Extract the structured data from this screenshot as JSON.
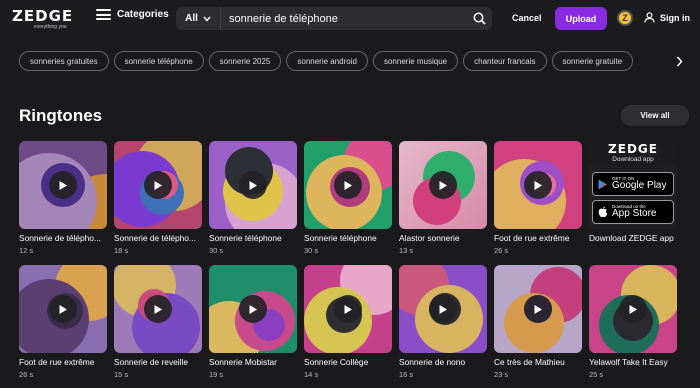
{
  "header": {
    "logo_text": "ZEDGE",
    "logo_tagline": "everything you",
    "categories_label": "Categories",
    "search_filter_value": "All",
    "search_value": "sonnerie de téléphone",
    "cancel_label": "Cancel",
    "upload_label": "Upload",
    "coin_label": "Z",
    "signin_label": "Sign in"
  },
  "tags": [
    "sonneries gratuites",
    "sonnerie téléphone",
    "sonnerie 2025",
    "sonnerie android",
    "sonnerie musique",
    "chanteur francais",
    "sonnerie gratuite"
  ],
  "section": {
    "title": "Ringtones",
    "view_all_label": "View all"
  },
  "ad": {
    "logo": "ZEDGE",
    "subtitle": "Download app",
    "google_small": "GET IT ON",
    "google_big": "Google Play",
    "apple_small": "Download on the",
    "apple_big": "App Store",
    "title": "Download ZEDGE app"
  },
  "row1": [
    {
      "title": "Sonnerie de télépho...",
      "duration": "12 s"
    },
    {
      "title": "Sonnerie de télépho...",
      "duration": "18 s"
    },
    {
      "title": "Sonnerie téléphone",
      "duration": "30 s"
    },
    {
      "title": "Sonnerie téléphone",
      "duration": "30 s"
    },
    {
      "title": "Alastor sonnerie",
      "duration": "13 s"
    },
    {
      "title": "Foot de rue extrême",
      "duration": "26 s"
    }
  ],
  "row2": [
    {
      "title": "Foot de rue extrême",
      "duration": "26 s"
    },
    {
      "title": "Sonnerie de reveille",
      "duration": "15 s"
    },
    {
      "title": "Sonnerie Mobistar",
      "duration": "19 s"
    },
    {
      "title": "Sonnerie Collège",
      "duration": "14 s"
    },
    {
      "title": "Sonnerie de nono",
      "duration": "16 s"
    },
    {
      "title": "Ce très de Mathieu",
      "duration": "23 s"
    },
    {
      "title": "Yelawolf Take It Easy",
      "duration": "25 s"
    }
  ],
  "colors": {
    "background": "#1a1a1c",
    "accent": "#8a2be2",
    "coin": "#f3c52c"
  }
}
